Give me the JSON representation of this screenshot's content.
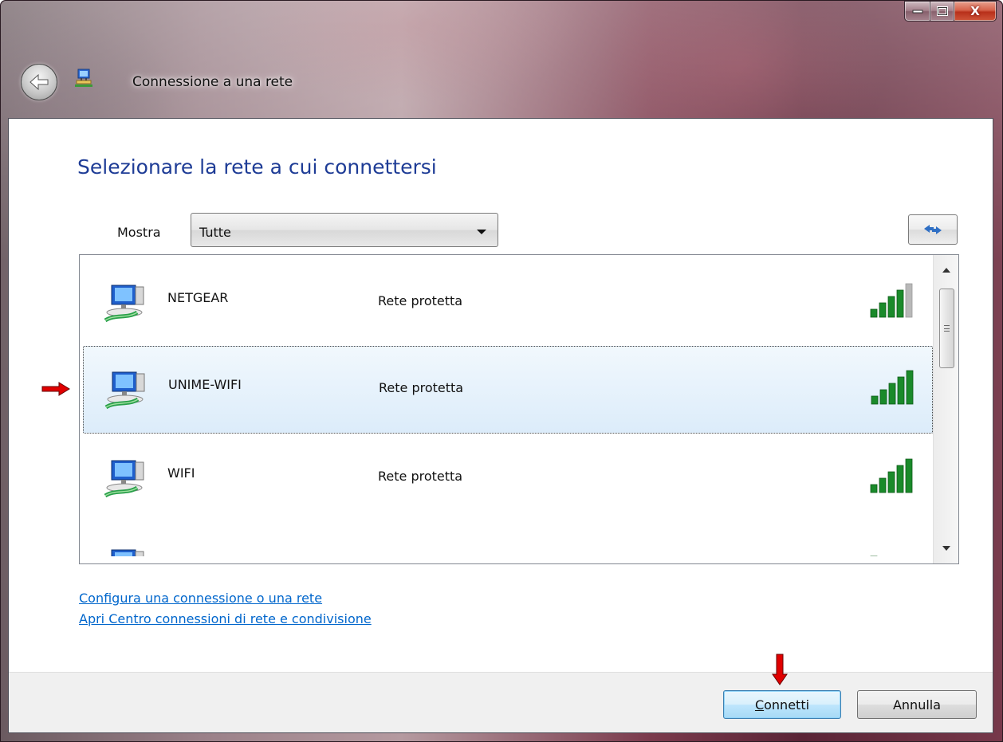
{
  "window": {
    "title": "Connessione a una rete",
    "caption_buttons": [
      "minimize",
      "maximize",
      "close"
    ],
    "close_glyph": "X"
  },
  "main": {
    "heading": "Selezionare la rete a cui connettersi",
    "show_label": "Mostra",
    "show_value": "Tutte",
    "refresh_icon": "refresh-arrows-icon"
  },
  "networks": [
    {
      "name": "NETGEAR",
      "status": "Rete protetta",
      "signal_bars": 4,
      "signal_max": 5
    },
    {
      "name": "UNIME-WIFI",
      "status": "Rete protetta",
      "signal_bars": 5,
      "signal_max": 5,
      "selected": true
    },
    {
      "name": "WIFI",
      "status": "Rete protetta",
      "signal_bars": 5,
      "signal_max": 5
    },
    {
      "name": "",
      "status": "",
      "signal_bars": 1,
      "signal_max": 5,
      "partially_visible": true
    }
  ],
  "links": {
    "setup": "Configura una connessione o una rete",
    "network_center": "Apri Centro connessioni di rete e condivisione"
  },
  "footer": {
    "connect_label_accel": "C",
    "connect_label_rest": "onnetti",
    "cancel_label": "Annulla"
  },
  "colors": {
    "heading": "#1e3c96",
    "link": "#0066cc",
    "signal_on": "#1a8a2a",
    "signal_off": "#b8b8b8",
    "annotation_arrow": "#e00000"
  }
}
